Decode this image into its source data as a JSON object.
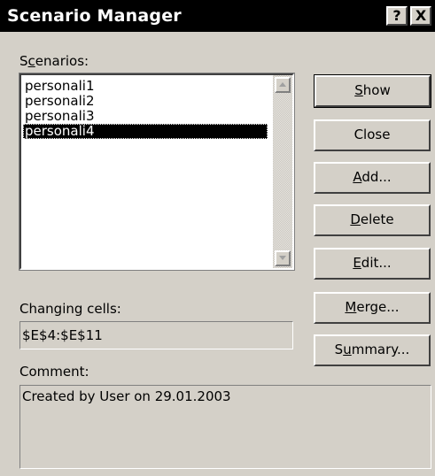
{
  "window": {
    "title": "Scenario Manager",
    "help_glyph": "?",
    "close_glyph": "X"
  },
  "scenarios": {
    "label_pre": "S",
    "label_mn": "c",
    "label_post": "enarios:",
    "items": [
      {
        "label": "personali1",
        "selected": false
      },
      {
        "label": "personali2",
        "selected": false
      },
      {
        "label": "personali3",
        "selected": false
      },
      {
        "label": "personali4",
        "selected": true
      }
    ]
  },
  "buttons": {
    "show": {
      "mn": "S",
      "rest": "how"
    },
    "close": {
      "label": "Close"
    },
    "add": {
      "mn": "A",
      "rest": "dd..."
    },
    "delete": {
      "mn": "D",
      "rest": "elete"
    },
    "edit": {
      "mn": "E",
      "rest": "dit..."
    },
    "merge": {
      "mn": "M",
      "rest": "erge..."
    },
    "summary": {
      "pre": "S",
      "mn": "u",
      "rest": "mmary..."
    }
  },
  "changing_cells": {
    "label": "Changing cells:",
    "value": "$E$4:$E$11"
  },
  "comment": {
    "label": "Comment:",
    "value": "Created by User on 29.01.2003"
  },
  "colors": {
    "titlebar_bg": "#000000",
    "dialog_bg": "#d4d0c8",
    "selection_bg": "#000000"
  }
}
